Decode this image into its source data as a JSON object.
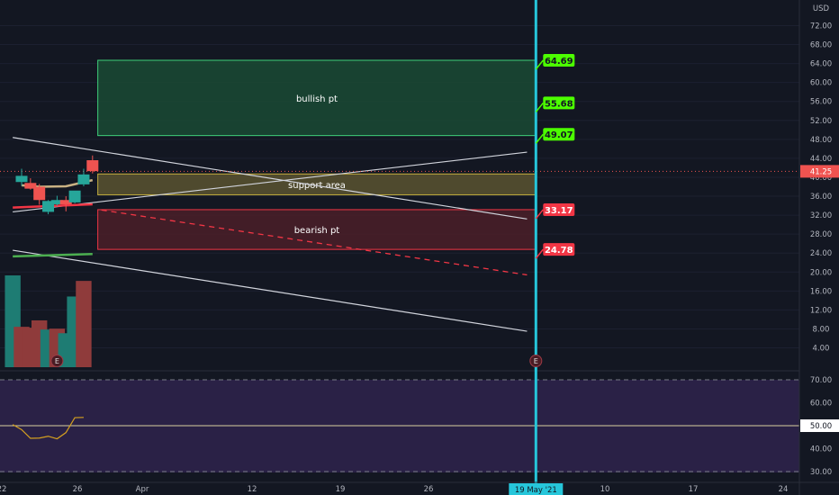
{
  "chart_data": {
    "type": "candlestick",
    "currency": "USD",
    "last_price": "41.25",
    "y_ticks": [
      "72.00",
      "68.00",
      "64.00",
      "60.00",
      "56.00",
      "52.00",
      "48.00",
      "44.00",
      "40.00",
      "36.00",
      "32.00",
      "28.00",
      "24.00",
      "20.00",
      "16.00",
      "12.00",
      "8.00",
      "4.00"
    ],
    "x_ticks": [
      "22",
      "26",
      "Apr",
      "12",
      "19",
      "26",
      "May",
      "10",
      "17",
      "24"
    ],
    "crosshair_date": "19 May '21",
    "crosshair_tick_days": 58,
    "rsi_ticks": [
      "70.00",
      "60.00",
      "50.00",
      "40.00",
      "30.00"
    ],
    "rsi_current": "50.00",
    "candles": [
      {
        "day": 0,
        "open": 39.0,
        "high": 41.8,
        "low": 38.2,
        "close": 40.3
      },
      {
        "day": 1,
        "open": 38.8,
        "high": 39.8,
        "low": 37.4,
        "close": 37.6
      },
      {
        "day": 2,
        "open": 38.0,
        "high": 38.6,
        "low": 34.2,
        "close": 35.2
      },
      {
        "day": 3,
        "open": 32.7,
        "high": 35.2,
        "low": 32.2,
        "close": 35.0
      },
      {
        "day": 4,
        "open": 34.3,
        "high": 36.1,
        "low": 34.0,
        "close": 35.2
      },
      {
        "day": 5,
        "open": 35.2,
        "high": 36.0,
        "low": 32.8,
        "close": 34.3
      },
      {
        "day": 6,
        "open": 34.7,
        "high": 36.9,
        "low": 34.5,
        "close": 37.2
      },
      {
        "day": 7,
        "open": 38.5,
        "high": 41.8,
        "low": 38.1,
        "close": 40.6
      },
      {
        "day": 8,
        "open": 43.6,
        "high": 44.6,
        "low": 40.8,
        "close": 41.3
      }
    ],
    "volume": [
      {
        "day": -1,
        "value": 100,
        "dir": "up"
      },
      {
        "day": 0,
        "value": 44,
        "dir": "down"
      },
      {
        "day": 1,
        "value": 43,
        "dir": "down"
      },
      {
        "day": 2,
        "value": 51,
        "dir": "down"
      },
      {
        "day": 3,
        "value": 41,
        "dir": "up"
      },
      {
        "day": 4,
        "value": 42,
        "dir": "down"
      },
      {
        "day": 5,
        "value": 37,
        "dir": "up"
      },
      {
        "day": 6,
        "value": 77,
        "dir": "up"
      },
      {
        "day": 7,
        "value": 94,
        "dir": "down"
      }
    ],
    "moving_averages": [
      {
        "color": "#c9b183",
        "points": [
          {
            "day": 0,
            "value": 38.3
          },
          {
            "day": 2,
            "value": 38.0
          },
          {
            "day": 5,
            "value": 38.1
          },
          {
            "day": 8,
            "value": 39.4
          }
        ]
      },
      {
        "color": "#f23645",
        "points": [
          {
            "day": -1,
            "value": 33.6
          },
          {
            "day": 8,
            "value": 34.3
          }
        ]
      },
      {
        "color": "#4caf50",
        "points": [
          {
            "day": -1,
            "value": 23.3
          },
          {
            "day": 8,
            "value": 23.8
          }
        ]
      }
    ],
    "zones": [
      {
        "label": "bullish pt",
        "top": 64.69,
        "bottom": 48.8,
        "start_day": 9,
        "fill": "#1a4a34",
        "stroke": "#3fd07a"
      },
      {
        "label": "support area",
        "top": 40.7,
        "bottom": 36.3,
        "start_day": 9,
        "fill": "#5a5330",
        "stroke": "#c4ae3e"
      },
      {
        "label": "bearish pt",
        "top": 33.17,
        "bottom": 24.78,
        "start_day": 9,
        "fill": "#4b1e28",
        "stroke": "#f23645"
      }
    ],
    "trend_lines": [
      {
        "color": "#d1d4dc",
        "dashed": false,
        "from": {
          "day": -1,
          "value": 48.4
        },
        "to": {
          "day": 57,
          "value": 31.2
        }
      },
      {
        "color": "#d1d4dc",
        "dashed": false,
        "from": {
          "day": -1,
          "value": 32.7
        },
        "to": {
          "day": 57,
          "value": 45.3
        }
      },
      {
        "color": "#d1d4dc",
        "dashed": false,
        "from": {
          "day": -1,
          "value": 24.6
        },
        "to": {
          "day": 57,
          "value": 7.5
        }
      },
      {
        "color": "#f23645",
        "dashed": true,
        "from": {
          "day": 9,
          "value": 33.1
        },
        "to": {
          "day": 57,
          "value": 19.4
        }
      }
    ],
    "targets": [
      {
        "label": "64.69",
        "value": 64.69,
        "kind": "bull"
      },
      {
        "label": "55.68",
        "value": 55.68,
        "kind": "bull"
      },
      {
        "label": "49.07",
        "value": 49.07,
        "kind": "bull"
      },
      {
        "label": "33.17",
        "value": 33.17,
        "kind": "bear"
      },
      {
        "label": "24.78",
        "value": 24.78,
        "kind": "bear"
      }
    ],
    "earnings_markers": [
      {
        "day": 4,
        "label": "E"
      },
      {
        "day": 58,
        "label": "E"
      }
    ],
    "rsi": [
      {
        "day": -1,
        "value": 50.5
      },
      {
        "day": 0,
        "value": 48.3
      },
      {
        "day": 1,
        "value": 44.5
      },
      {
        "day": 2,
        "value": 44.6
      },
      {
        "day": 3,
        "value": 45.4
      },
      {
        "day": 4,
        "value": 44.3
      },
      {
        "day": 5,
        "value": 47.0
      },
      {
        "day": 6,
        "value": 53.5
      },
      {
        "day": 7,
        "value": 53.6
      }
    ],
    "colors": {
      "background": "#131722",
      "up": "#26a69a",
      "down": "#ef5350",
      "bull_target": "#4cff00",
      "bear_target": "#f23645",
      "crosshair": "#26c6da",
      "rsi_fill": "#2a2146"
    }
  }
}
